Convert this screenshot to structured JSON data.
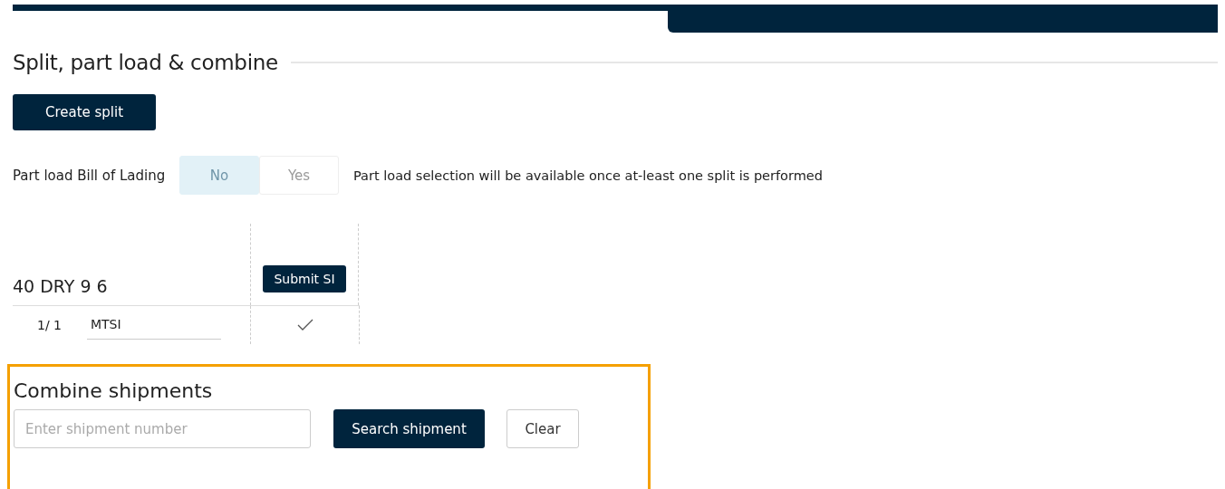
{
  "section": {
    "title": "Split, part load & combine"
  },
  "create_button": "Create split",
  "part_load": {
    "label": "Part load Bill of Lading",
    "disabled": true,
    "options": [
      {
        "label": "No",
        "selected": true
      },
      {
        "label": "Yes",
        "selected": false
      }
    ],
    "note": "Part load selection will be available once at-least one split is performed"
  },
  "container_table": {
    "container": "40 DRY 9 6",
    "action": "Submit SI",
    "rows": [
      {
        "index": "1/ 1",
        "value": "MTSI",
        "checked": true
      }
    ]
  },
  "combine": {
    "title": "Combine shipments",
    "placeholder": "Enter shipment number",
    "search_button": "Search shipment",
    "clear_button": "Clear"
  }
}
